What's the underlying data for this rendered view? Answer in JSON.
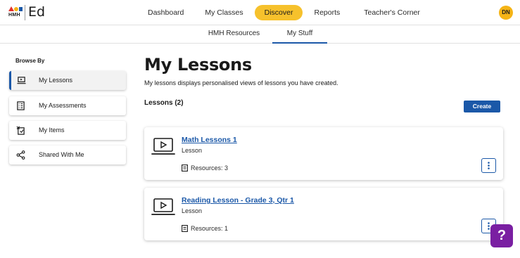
{
  "brand": {
    "logo_text": "HMH",
    "product": "Ed"
  },
  "nav": {
    "items": [
      {
        "label": "Dashboard",
        "active": false
      },
      {
        "label": "My Classes",
        "active": false
      },
      {
        "label": "Discover",
        "active": true
      },
      {
        "label": "Reports",
        "active": false
      },
      {
        "label": "Teacher's Corner",
        "active": false
      }
    ],
    "accent_color": "#f6c12c"
  },
  "user": {
    "initials": "DN",
    "avatar_color": "#f5b416"
  },
  "subnav": {
    "tabs": [
      {
        "label": "HMH Resources",
        "active": false
      },
      {
        "label": "My Stuff",
        "active": true
      }
    ],
    "active_color": "#1b58a8"
  },
  "sidebar": {
    "heading": "Browse By",
    "items": [
      {
        "label": "My Lessons",
        "icon": "laptop-icon",
        "active": true
      },
      {
        "label": "My Assessments",
        "icon": "checklist-icon",
        "active": false
      },
      {
        "label": "My Items",
        "icon": "items-icon",
        "active": false
      },
      {
        "label": "Shared With Me",
        "icon": "share-icon",
        "active": false
      }
    ]
  },
  "main": {
    "title": "My Lessons",
    "description": "My lessons displays personalised views of lessons you have created.",
    "count_label": "Lessons (2)",
    "create_label": "Create",
    "lessons": [
      {
        "title": "Math Lessons 1",
        "type": "Lesson",
        "resources": "Resources: 3",
        "icon": "video-lesson-icon"
      },
      {
        "title": "Reading Lesson - Grade 3, Qtr 1",
        "type": "Lesson",
        "resources": "Resources: 1",
        "icon": "video-lesson-icon"
      }
    ]
  },
  "help": {
    "label": "?",
    "color": "#7a1fa2"
  }
}
